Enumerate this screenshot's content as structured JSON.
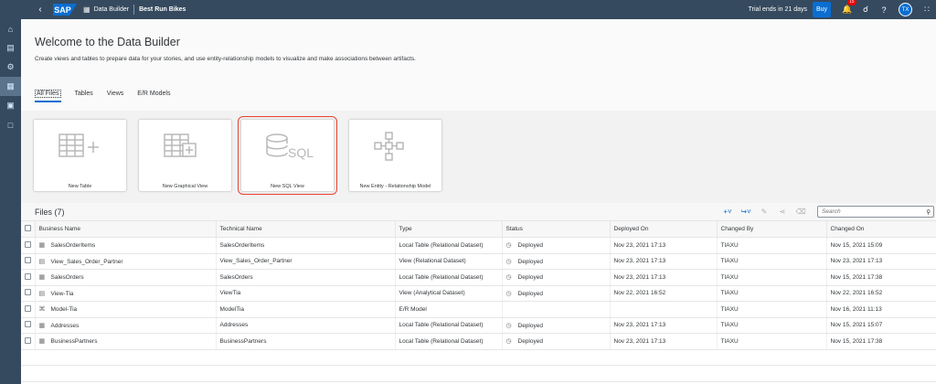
{
  "shell": {
    "logo": "SAP",
    "app_title": "Data Builder",
    "space": "Best Run Bikes",
    "trial": "Trial ends in 21 days",
    "buy": "Buy",
    "notifications_count": "15",
    "avatar": "TX"
  },
  "header": {
    "title": "Welcome to the Data Builder",
    "subtitle": "Create views and tables to prepare data for your stories, and use entity-relationship models to visualize and make associations between artifacts.",
    "tabs": [
      "All Files",
      "Tables",
      "Views",
      "E/R Models"
    ]
  },
  "tiles": [
    {
      "label": "New Table",
      "icon": "table-plus-icon"
    },
    {
      "label": "New Graphical View",
      "icon": "graphical-view-plus-icon"
    },
    {
      "label": "New SQL View",
      "icon": "sql-icon"
    },
    {
      "label": "New Entity - Relationship Model",
      "icon": "er-model-icon"
    }
  ],
  "files": {
    "title": "Files (7)",
    "search_placeholder": "Search",
    "columns": [
      "Business Name",
      "Technical Name",
      "Type",
      "Status",
      "Deployed On",
      "Changed By",
      "Changed On"
    ],
    "rows": [
      {
        "business": "SalesOrderItems",
        "technical": "SalesOrderItems",
        "type": "Local Table (Relational Dataset)",
        "status": "Deployed",
        "deployed_on": "Nov 23, 2021 17:13",
        "changed_by": "TIAXU",
        "changed_on": "Nov 15, 2021 15:09",
        "icon": "table-icon"
      },
      {
        "business": "View_Sales_Order_Partner",
        "technical": "View_Sales_Order_Partner",
        "type": "View (Relational Dataset)",
        "status": "Deployed",
        "deployed_on": "Nov 23, 2021 17:13",
        "changed_by": "TIAXU",
        "changed_on": "Nov 23, 2021 17:13",
        "icon": "view-icon"
      },
      {
        "business": "SalesOrders",
        "technical": "SalesOrders",
        "type": "Local Table (Relational Dataset)",
        "status": "Deployed",
        "deployed_on": "Nov 23, 2021 17:13",
        "changed_by": "TIAXU",
        "changed_on": "Nov 15, 2021 17:38",
        "icon": "table-icon"
      },
      {
        "business": "View-Tia",
        "technical": "ViewTia",
        "type": "View (Analytical Dataset)",
        "status": "Deployed",
        "deployed_on": "Nov 22, 2021 16:52",
        "changed_by": "TIAXU",
        "changed_on": "Nov 22, 2021 16:52",
        "icon": "view-icon"
      },
      {
        "business": "Model-Tia",
        "technical": "ModelTia",
        "type": "E/R Model",
        "status": "",
        "deployed_on": "",
        "changed_by": "TIAXU",
        "changed_on": "Nov 16, 2021 11:13",
        "icon": "er-model-icon"
      },
      {
        "business": "Addresses",
        "technical": "Addresses",
        "type": "Local Table (Relational Dataset)",
        "status": "Deployed",
        "deployed_on": "Nov 23, 2021 17:13",
        "changed_by": "TIAXU",
        "changed_on": "Nov 15, 2021 15:07",
        "icon": "table-icon"
      },
      {
        "business": "BusinessPartners",
        "technical": "BusinessPartners",
        "type": "Local Table (Relational Dataset)",
        "status": "Deployed",
        "deployed_on": "Nov 23, 2021 17:13",
        "changed_by": "TIAXU",
        "changed_on": "Nov 15, 2021 17:38",
        "icon": "table-icon"
      }
    ]
  }
}
